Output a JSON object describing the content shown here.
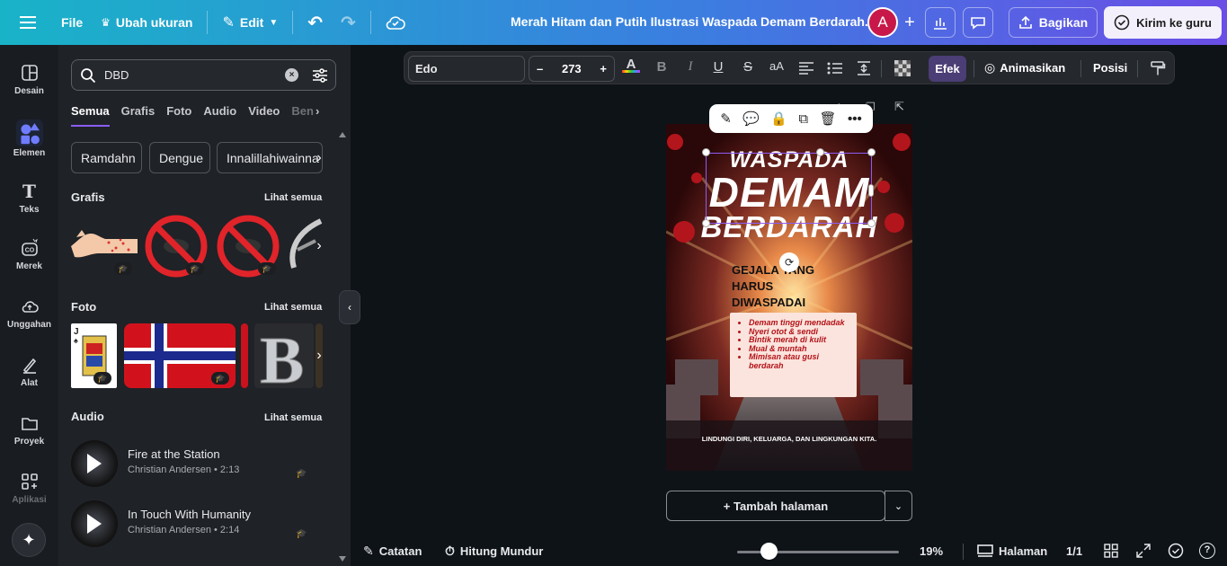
{
  "topbar": {
    "file": "File",
    "resize": "Ubah ukuran",
    "edit": "Edit",
    "doc_title": "Merah Hitam dan Putih Ilustrasi Waspada Demam Berdarah...",
    "avatar": "A",
    "share": "Bagikan",
    "send_teacher": "Kirim ke guru"
  },
  "rail": {
    "items": [
      "Desain",
      "Elemen",
      "Teks",
      "Merek",
      "Unggahan",
      "Alat",
      "Proyek",
      "Aplikasi"
    ]
  },
  "panel": {
    "search_value": "DBD",
    "tabs": [
      "Semua",
      "Grafis",
      "Foto",
      "Audio",
      "Video",
      "Ben"
    ],
    "chips": [
      "Ramdahn",
      "Dengue",
      "Innalillahiwainna"
    ],
    "grafis_title": "Grafis",
    "foto_title": "Foto",
    "audio_title": "Audio",
    "see_all": "Lihat semua",
    "audio": [
      {
        "title": "Fire at the Station",
        "meta": "Christian Andersen • 2:13"
      },
      {
        "title": "In Touch With Humanity",
        "meta": "Christian Andersen • 2:14"
      }
    ]
  },
  "toolbar": {
    "font": "Edo",
    "size": "273",
    "efek": "Efek",
    "animate": "Animasikan",
    "position": "Posisi"
  },
  "design": {
    "line1": "WASPADA",
    "line2": "DEMAM",
    "line3": "BERDARAH",
    "sub1": "GEJALA YANG",
    "sub2": "HARUS",
    "sub3": "DIWASPADAI",
    "bullets": [
      "Demam tinggi mendadak",
      "Nyeri otot & sendi",
      "Bintik merah di kulit",
      "Mual & muntah",
      "Mimisan atau gusi berdarah"
    ],
    "footer": "LINDUNGI DIRI, KELUARGA, DAN LINGKUNGAN KITA."
  },
  "canvas": {
    "add_page": "+ Tambah halaman"
  },
  "bottom": {
    "notes": "Catatan",
    "timer": "Hitung Mundur",
    "zoom": "19%",
    "pages_label": "Halaman",
    "page_count": "1/1"
  },
  "colors": {
    "accent": "#8b5cf6",
    "bg": "#0e1318",
    "panel": "#1f2227"
  }
}
